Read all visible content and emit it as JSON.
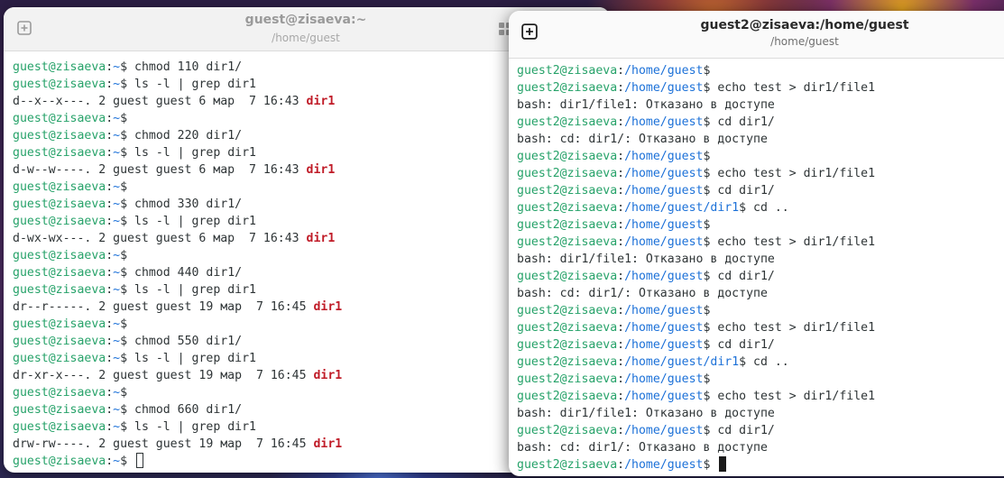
{
  "colors": {
    "prompt_user": "#26a269",
    "prompt_path": "#1c71d8",
    "dir_name": "#c01c28",
    "text": "#2e3436"
  },
  "window1": {
    "title": "guest@zisaeva:~",
    "subtitle": "/home/guest",
    "prompt_user": "guest@zisaeva",
    "prompt_path": "~",
    "lines": [
      {
        "type": "cmd",
        "text": "chmod 110 dir1/"
      },
      {
        "type": "cmd",
        "text": "ls -l | grep dir1"
      },
      {
        "type": "ls",
        "text": "d--x--x---. 2 guest guest 6 мар  7 16:43 ",
        "name": "dir1"
      },
      {
        "type": "cmd",
        "text": ""
      },
      {
        "type": "cmd",
        "text": "chmod 220 dir1/"
      },
      {
        "type": "cmd",
        "text": "ls -l | grep dir1"
      },
      {
        "type": "ls",
        "text": "d-w--w----. 2 guest guest 6 мар  7 16:43 ",
        "name": "dir1"
      },
      {
        "type": "cmd",
        "text": ""
      },
      {
        "type": "cmd",
        "text": "chmod 330 dir1/"
      },
      {
        "type": "cmd",
        "text": "ls -l | grep dir1"
      },
      {
        "type": "ls",
        "text": "d-wx-wx---. 2 guest guest 6 мар  7 16:43 ",
        "name": "dir1"
      },
      {
        "type": "cmd",
        "text": ""
      },
      {
        "type": "cmd",
        "text": "chmod 440 dir1/"
      },
      {
        "type": "cmd",
        "text": "ls -l | grep dir1"
      },
      {
        "type": "ls",
        "text": "dr--r-----. 2 guest guest 19 мар  7 16:45 ",
        "name": "dir1"
      },
      {
        "type": "cmd",
        "text": ""
      },
      {
        "type": "cmd",
        "text": "chmod 550 dir1/"
      },
      {
        "type": "cmd",
        "text": "ls -l | grep dir1"
      },
      {
        "type": "ls",
        "text": "dr-xr-x---. 2 guest guest 19 мар  7 16:45 ",
        "name": "dir1"
      },
      {
        "type": "cmd",
        "text": ""
      },
      {
        "type": "cmd",
        "text": "chmod 660 dir1/"
      },
      {
        "type": "cmd",
        "text": "ls -l | grep dir1"
      },
      {
        "type": "ls",
        "text": "drw-rw----. 2 guest guest 19 мар  7 16:45 ",
        "name": "dir1"
      },
      {
        "type": "cursor",
        "text": ""
      }
    ]
  },
  "window2": {
    "title": "guest2@zisaeva:/home/guest",
    "subtitle": "/home/guest",
    "prompt_user": "guest2@zisaeva",
    "lines": [
      {
        "type": "cmd",
        "path": "/home/guest",
        "text": ""
      },
      {
        "type": "cmd",
        "path": "/home/guest",
        "text": "echo test > dir1/file1"
      },
      {
        "type": "out",
        "text": "bash: dir1/file1: Отказано в доступе"
      },
      {
        "type": "cmd",
        "path": "/home/guest",
        "text": "cd dir1/"
      },
      {
        "type": "out",
        "text": "bash: cd: dir1/: Отказано в доступе"
      },
      {
        "type": "cmd",
        "path": "/home/guest",
        "text": ""
      },
      {
        "type": "cmd",
        "path": "/home/guest",
        "text": "echo test > dir1/file1"
      },
      {
        "type": "cmd",
        "path": "/home/guest",
        "text": "cd dir1/"
      },
      {
        "type": "cmd",
        "path": "/home/guest/dir1",
        "text": "cd .."
      },
      {
        "type": "cmd",
        "path": "/home/guest",
        "text": ""
      },
      {
        "type": "cmd",
        "path": "/home/guest",
        "text": "echo test > dir1/file1"
      },
      {
        "type": "out",
        "text": "bash: dir1/file1: Отказано в доступе"
      },
      {
        "type": "cmd",
        "path": "/home/guest",
        "text": "cd dir1/"
      },
      {
        "type": "out",
        "text": "bash: cd: dir1/: Отказано в доступе"
      },
      {
        "type": "cmd",
        "path": "/home/guest",
        "text": ""
      },
      {
        "type": "cmd",
        "path": "/home/guest",
        "text": "echo test > dir1/file1"
      },
      {
        "type": "cmd",
        "path": "/home/guest",
        "text": "cd dir1/"
      },
      {
        "type": "cmd",
        "path": "/home/guest/dir1",
        "text": "cd .."
      },
      {
        "type": "cmd",
        "path": "/home/guest",
        "text": ""
      },
      {
        "type": "cmd",
        "path": "/home/guest",
        "text": "echo test > dir1/file1"
      },
      {
        "type": "out",
        "text": "bash: dir1/file1: Отказано в доступе"
      },
      {
        "type": "cmd",
        "path": "/home/guest",
        "text": "cd dir1/"
      },
      {
        "type": "out",
        "text": "bash: cd: dir1/: Отказано в доступе"
      },
      {
        "type": "cursor",
        "path": "/home/guest",
        "text": ""
      }
    ]
  }
}
